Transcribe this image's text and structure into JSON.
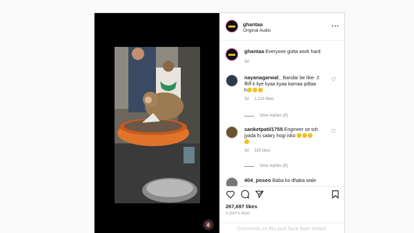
{
  "post": {
    "username": "ghantaa",
    "audio": "Original Audio",
    "caption_user": "ghantaa",
    "caption_text": "Everyone gotta work hard",
    "caption_time": "3d",
    "likes": "267,697 likes",
    "time_ago": "3 DAYS AGO",
    "limited_notice": "Comments on this post have been limited."
  },
  "comments": [
    {
      "username": "nayanagarwal_",
      "text_line1": "Bandar be like- 2",
      "text_line2": "केले k liye kyaa kyaa kamaa pdtaa",
      "text_line3": "h",
      "time": "3d",
      "likes": "1,219 likes",
      "view_replies": "View replies (8)"
    },
    {
      "username": "sanketpatil1755",
      "text_line1": "Engineer se toh",
      "text_line2": "jyada hi salary hogi isko",
      "time": "3d",
      "likes": "320 likes",
      "view_replies": "View replies (8)"
    },
    {
      "username": "404_poseo",
      "text_line1": "Baba ko dhaba wale"
    }
  ],
  "icons": {
    "more": "more-options-icon",
    "like": "heart-icon",
    "comment": "comment-icon",
    "share": "share-icon",
    "save": "bookmark-icon",
    "mute": "mute-icon"
  },
  "colors": {
    "story_ring": "#c13584",
    "muted_text": "#8e8e8e",
    "border": "#dbdbdb"
  }
}
